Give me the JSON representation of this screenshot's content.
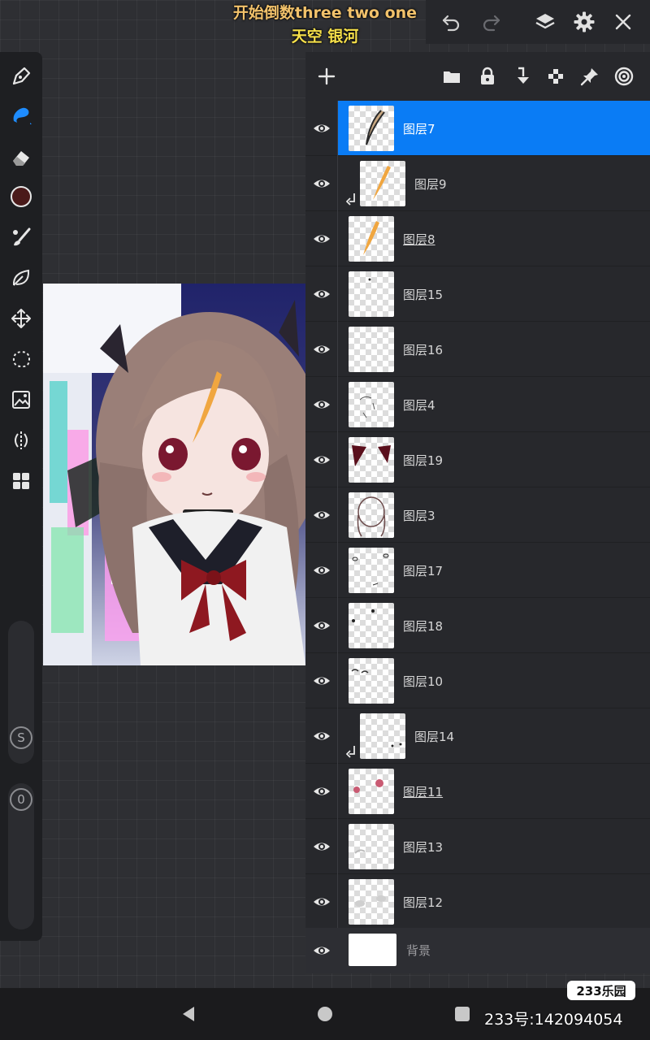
{
  "caption": {
    "line1": "开始倒数three two one",
    "line2": "天空 银河"
  },
  "topbar": {
    "icons": [
      "undo-icon",
      "redo-icon",
      "layers-icon",
      "settings-icon",
      "close-icon"
    ]
  },
  "sidebar": {
    "tools": [
      "pen-icon",
      "smudge-icon",
      "eraser-icon",
      "color-swatch",
      "brush-icon",
      "leaf-icon",
      "move-icon",
      "lasso-icon",
      "image-adjust-icon",
      "symmetry-icon",
      "grid-icon"
    ],
    "current_color": "#4a1a1a",
    "size_slider_label": "S",
    "opacity_slider_label": "0"
  },
  "layer_toolbar": {
    "icons": [
      "add-layer-icon",
      "folder-icon",
      "lock-icon",
      "merge-down-icon",
      "transparency-icon",
      "pin-icon",
      "blend-icon"
    ]
  },
  "layers": [
    {
      "name": "图层7",
      "selected": true,
      "clipped": false,
      "underline": false
    },
    {
      "name": "图层9",
      "selected": false,
      "clipped": true,
      "underline": false
    },
    {
      "name": "图层8",
      "selected": false,
      "clipped": false,
      "underline": true
    },
    {
      "name": "图层15",
      "selected": false,
      "clipped": false,
      "underline": false
    },
    {
      "name": "图层16",
      "selected": false,
      "clipped": false,
      "underline": false
    },
    {
      "name": "图层4",
      "selected": false,
      "clipped": false,
      "underline": false
    },
    {
      "name": "图层19",
      "selected": false,
      "clipped": false,
      "underline": false
    },
    {
      "name": "图层3",
      "selected": false,
      "clipped": false,
      "underline": false
    },
    {
      "name": "图层17",
      "selected": false,
      "clipped": false,
      "underline": false
    },
    {
      "name": "图层18",
      "selected": false,
      "clipped": false,
      "underline": false
    },
    {
      "name": "图层10",
      "selected": false,
      "clipped": false,
      "underline": false
    },
    {
      "name": "图层14",
      "selected": false,
      "clipped": true,
      "underline": false
    },
    {
      "name": "图层11",
      "selected": false,
      "clipped": false,
      "underline": true
    },
    {
      "name": "图层13",
      "selected": false,
      "clipped": false,
      "underline": false
    },
    {
      "name": "图层12",
      "selected": false,
      "clipped": false,
      "underline": false
    }
  ],
  "background_layer": {
    "name": "背景"
  },
  "watermark": {
    "logo": "233乐园",
    "id": "233号:142094054"
  },
  "colors": {
    "accent": "#0a7cf5",
    "caption_orange": "#f2c26b",
    "caption_yellow": "#f6e04a"
  }
}
